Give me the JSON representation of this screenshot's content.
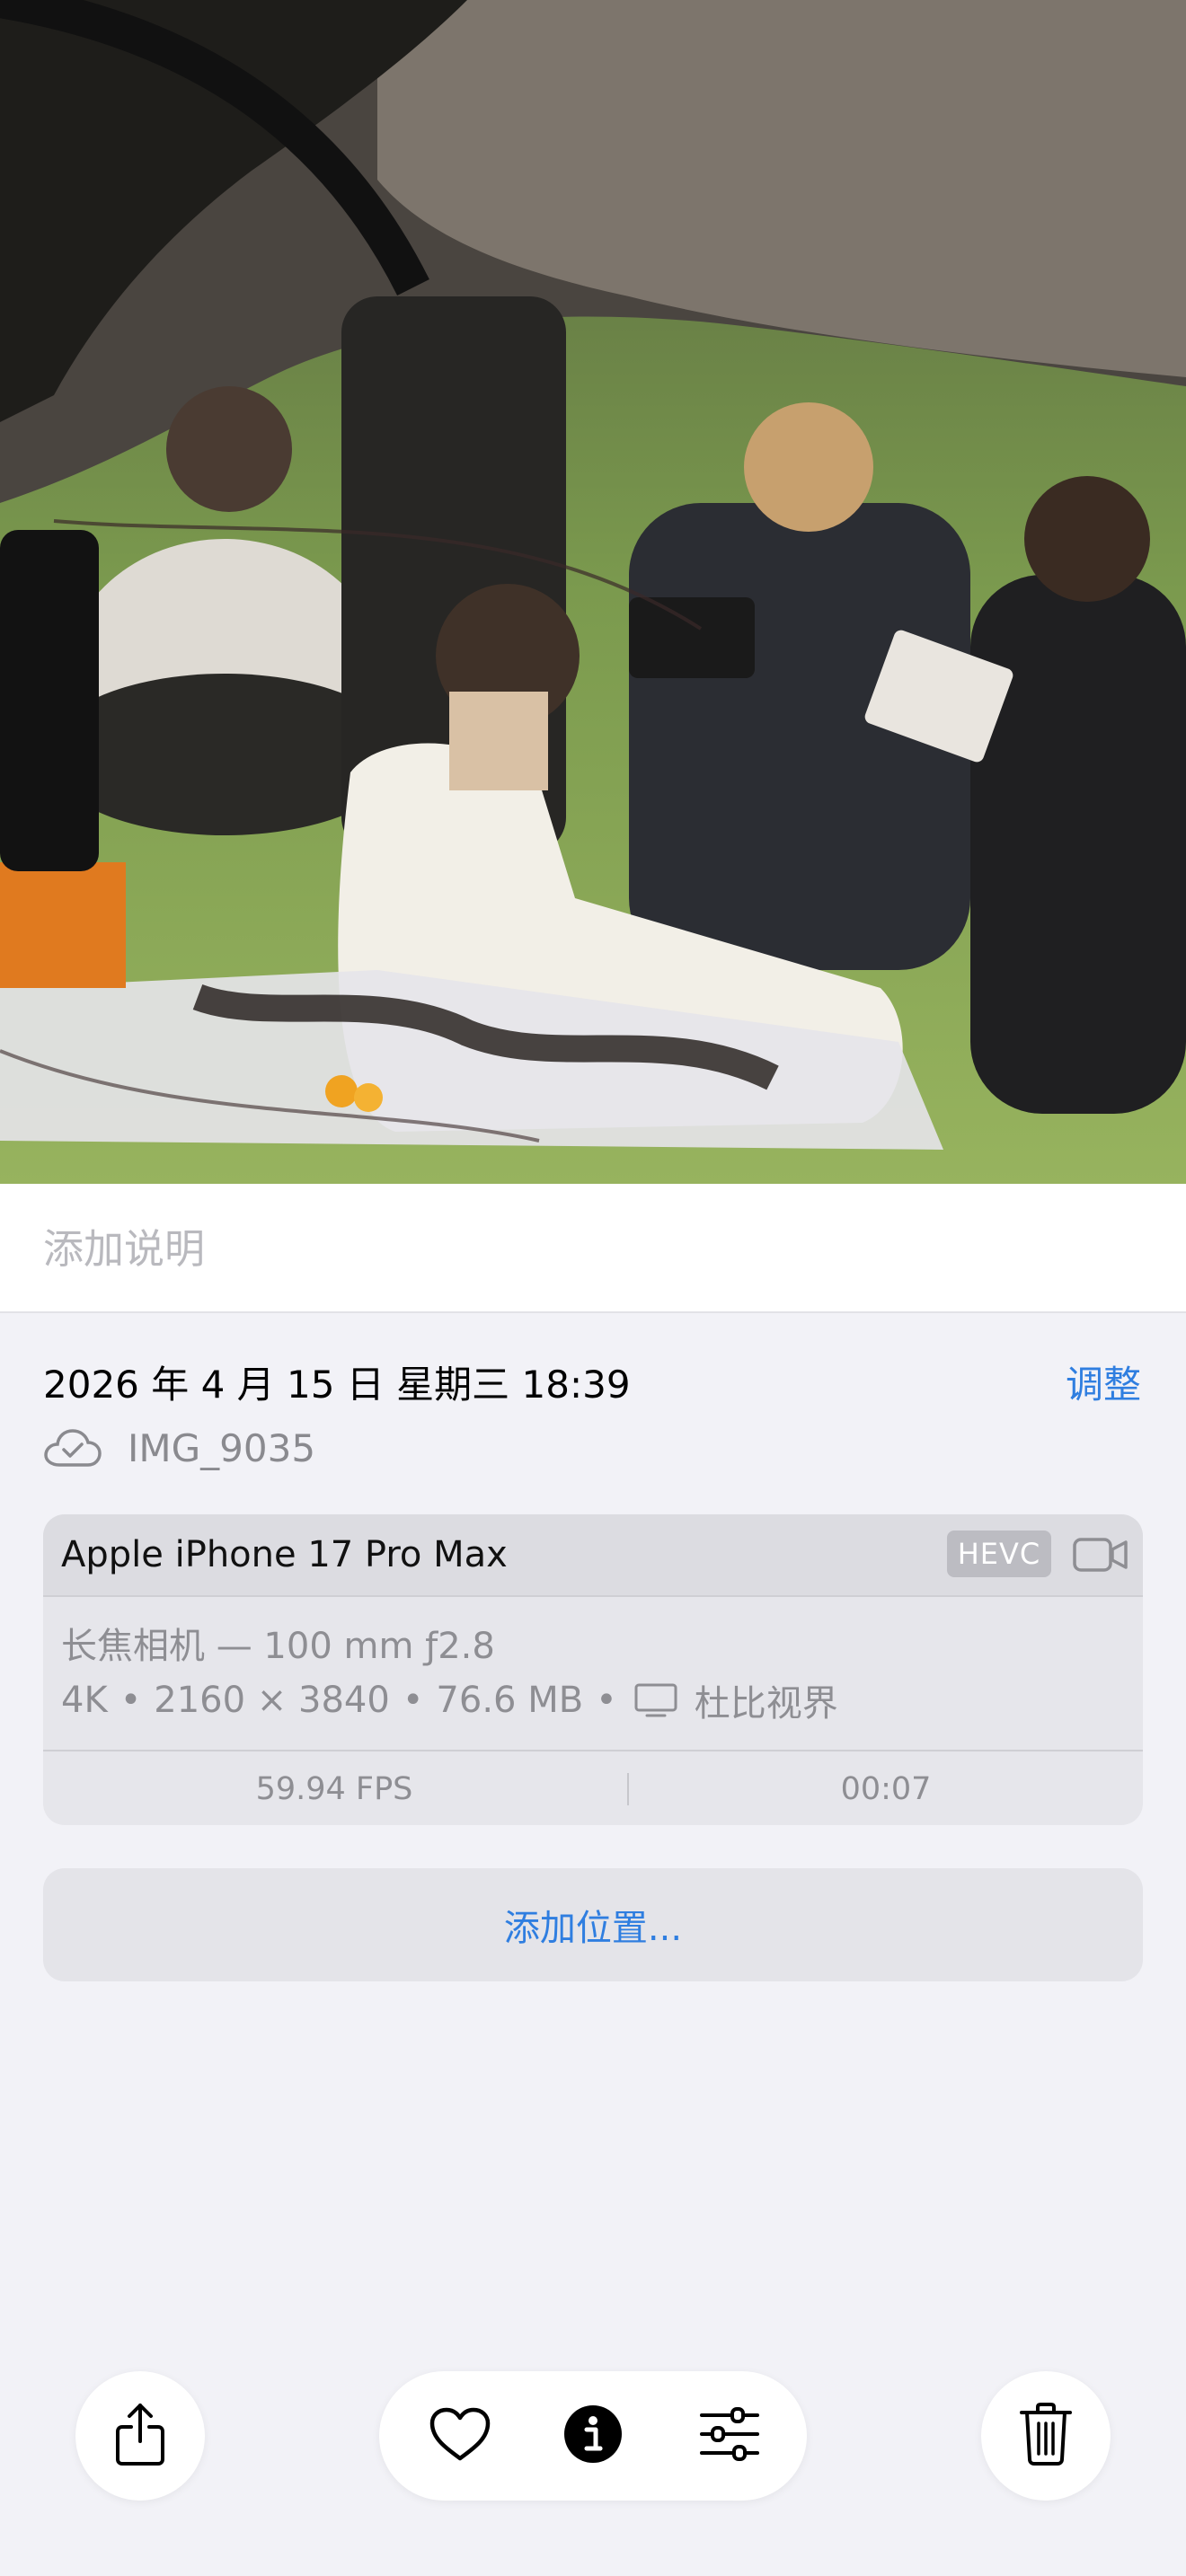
{
  "caption": {
    "placeholder": "添加说明"
  },
  "info": {
    "datetime": "2026 年 4 月 15 日  星期三 18:39",
    "adjust_label": "调整",
    "filename": "IMG_9035",
    "cloud_icon": "icloud-check-icon"
  },
  "camera": {
    "device": "Apple iPhone 17 Pro Max",
    "codec_badge": "HEVC",
    "media_icon": "video-camera-icon",
    "lens": "长焦相机 — 100 mm ƒ2.8",
    "resolution": "4K",
    "dimensions": "2160 × 3840",
    "size": "76.6 MB",
    "display_icon": "display-icon",
    "hdr": "杜比视界",
    "separator": "•",
    "fps": "59.94 FPS",
    "duration": "00:07"
  },
  "location": {
    "add_label": "添加位置..."
  },
  "toolbar": {
    "share_icon": "share-icon",
    "favorite_icon": "heart-icon",
    "info_icon": "info-filled-icon",
    "edit_icon": "sliders-icon",
    "delete_icon": "trash-icon"
  },
  "colors": {
    "accent": "#2f7ee0",
    "background": "#f2f2f7",
    "secondary_text": "#8e8e93"
  }
}
